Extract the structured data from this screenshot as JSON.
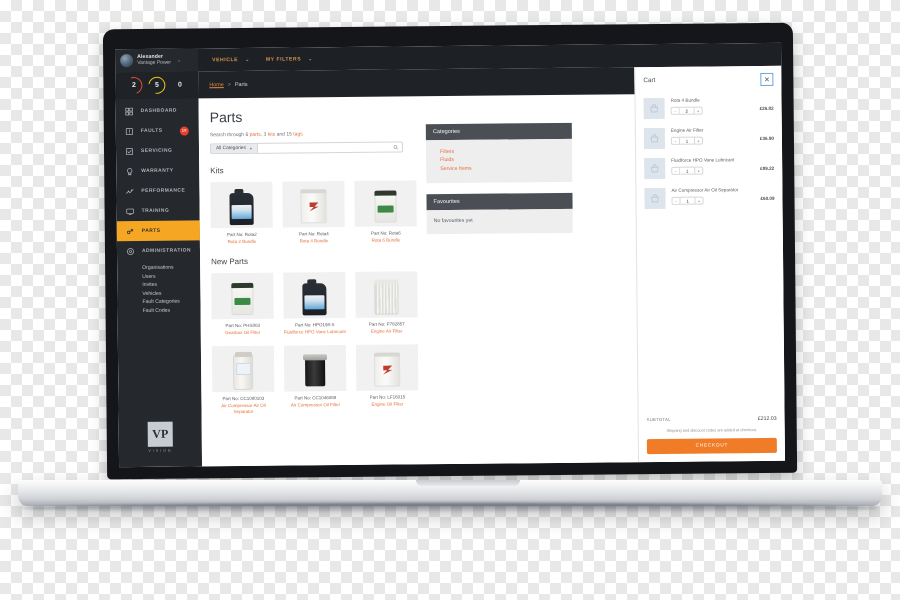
{
  "topbar": {
    "user_name": "Alexander",
    "user_org": "Vantage Power",
    "chevron": "⌄",
    "menu": [
      {
        "label": "VEHICLE",
        "icon": "chevron-down-icon"
      },
      {
        "label": "MY FILTERS",
        "icon": "chevron-down-icon"
      }
    ]
  },
  "sidebar": {
    "stats": [
      {
        "value": "2",
        "color": "#e0502f"
      },
      {
        "value": "5",
        "color": "#f2c417"
      },
      {
        "value": "0",
        "color": "#6d7278"
      }
    ],
    "items": [
      {
        "label": "DASHBOARD",
        "icon": "dashboard-icon",
        "badge": ""
      },
      {
        "label": "FAULTS",
        "icon": "fault-icon",
        "badge": "10"
      },
      {
        "label": "SERVICING",
        "icon": "servicing-icon",
        "badge": ""
      },
      {
        "label": "WARRANTY",
        "icon": "warranty-icon",
        "badge": ""
      },
      {
        "label": "PERFORMANCE",
        "icon": "performance-icon",
        "badge": ""
      },
      {
        "label": "TRAINING",
        "icon": "training-icon",
        "badge": ""
      },
      {
        "label": "PARTS",
        "icon": "parts-icon",
        "badge": ""
      },
      {
        "label": "ADMINISTRATION",
        "icon": "administration-icon",
        "badge": ""
      }
    ],
    "subitems": [
      "Organisations",
      "Users",
      "Invites",
      "Vehicles",
      "Fault Categories",
      "Fault Codes"
    ],
    "logo_mark": "VP",
    "logo_word": "VISION"
  },
  "breadcrumb": {
    "home": "Home",
    "separator": ">",
    "current": "Parts"
  },
  "page": {
    "title": "Parts",
    "search_note_prefix": "Search through 6 ",
    "search_note_parts": "parts",
    "search_note_mid": ", 3 ",
    "search_note_kits": "kits",
    "search_note_and": " and 15 ",
    "search_note_tags": "tags",
    "category_select": "All Categories",
    "category_caret": "▾",
    "search_placeholder": "",
    "search_value": "",
    "kits_heading": "Kits",
    "new_parts_heading": "New Parts"
  },
  "kits": [
    {
      "part_no": "Part No: Rota2",
      "name": "Rota 2 Bundle",
      "shape": "bottle"
    },
    {
      "part_no": "Part No: Rota4",
      "name": "Rota 4 Bundle",
      "shape": "drum"
    },
    {
      "part_no": "Part No: Rota6",
      "name": "Rota 6 Bundle",
      "shape": "canister"
    }
  ],
  "new_parts": [
    {
      "part_no": "Part No: PHS803",
      "name": "Gearbox Oil Filter",
      "shape": "canister"
    },
    {
      "part_no": "Part No: HPO198-S",
      "name": "Fluidforce HPO Vane Lubricant",
      "shape": "bottle"
    },
    {
      "part_no": "Part No: P782857",
      "name": "Engine Air Filter",
      "shape": "pleated"
    },
    {
      "part_no": "Part No: CC1080103",
      "name": "Air Compressor Air Oil Separator",
      "shape": "separator"
    },
    {
      "part_no": "Part No: CC1046088",
      "name": "Air Compressor Oil Filter",
      "shape": "spinon"
    },
    {
      "part_no": "Part No: LF16015",
      "name": "Engine Oil Filter",
      "shape": "drum"
    }
  ],
  "categories_panel": {
    "title": "Categories",
    "links": [
      "Filters",
      "Fluids",
      "Service Items"
    ]
  },
  "favourites_panel": {
    "title": "Favourites",
    "empty_text": "No favourites yet"
  },
  "cart": {
    "title": "Cart",
    "close_label": "✕",
    "minus": "-",
    "plus": "+",
    "items": [
      {
        "name": "Rota 4 Bundle",
        "qty": "2",
        "price": "£26.82"
      },
      {
        "name": "Engine Air Filter",
        "qty": "1",
        "price": "£36.90"
      },
      {
        "name": "Fluidforce HPO Vane Lubricant",
        "qty": "1",
        "price": "£89.22"
      },
      {
        "name": "Air Compressor Air Oil Separator",
        "qty": "1",
        "price": "£60.09"
      }
    ],
    "subtotal_label": "SUBTOTAL",
    "subtotal_value": "£212.03",
    "shipping_note": "Shipping and discount codes are added at checkout.",
    "checkout_label": "CHECKOUT"
  },
  "colors": {
    "accent_orange": "#f5a623",
    "link_orange": "#e2703a",
    "checkout_orange": "#f07c27",
    "sidebar_dark": "#25282d",
    "topbar_dark": "#1d2024",
    "panel_head": "#4b4f55"
  }
}
